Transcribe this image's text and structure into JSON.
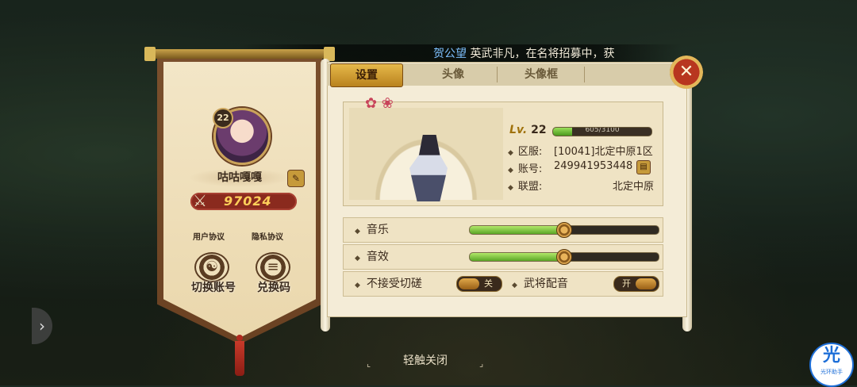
{
  "marquee": {
    "name": "贺公望",
    "text": "英武非凡，在名将招募中，获"
  },
  "player": {
    "level": "22",
    "name": "咕咕嘎嘎",
    "power": "97024",
    "user_agreement": "用户协议",
    "privacy_agreement": "隐私协议",
    "switch_account": "切换账号",
    "redeem_code": "兑换码"
  },
  "tabs": [
    {
      "label": "设置",
      "active": true
    },
    {
      "label": "头像",
      "active": false
    },
    {
      "label": "头像框",
      "active": false
    }
  ],
  "info": {
    "lv_tag": "Lv.",
    "lv_value": "22",
    "exp_text": "605/3100",
    "exp_fraction": 0.195,
    "server_label": "区服:",
    "server_value": "[10041]北定中原1区",
    "account_label": "账号:",
    "account_value": "249941953448",
    "alliance_label": "联盟:",
    "alliance_value": "北定中原"
  },
  "settings": {
    "music_label": "音乐",
    "music_level": 0.5,
    "sfx_label": "音效",
    "sfx_level": 0.5,
    "no_duel_label": "不接受切磋",
    "no_duel_state": "关",
    "voice_label": "武将配音",
    "voice_state": "开"
  },
  "footer": {
    "tap_close": "轻触关闭"
  },
  "assistant": {
    "glyph": "光",
    "label": "光环助手"
  },
  "colors": {
    "accent_gold": "#e6b94a",
    "power_red": "#8a2a1e",
    "bar_green": "#5aa626",
    "close_red": "#b8361f"
  }
}
